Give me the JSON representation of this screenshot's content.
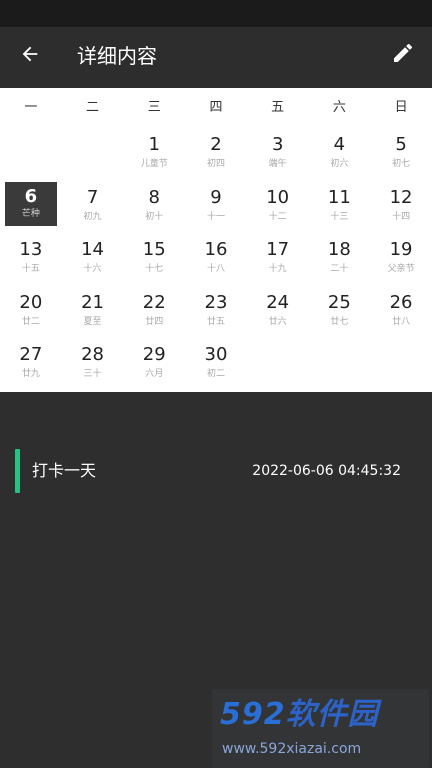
{
  "appbar": {
    "title": "详细内容",
    "back_icon": "arrow-back-icon",
    "edit_icon": "pencil-edit-icon"
  },
  "calendar": {
    "weekdays": [
      "一",
      "二",
      "三",
      "四",
      "五",
      "六",
      "日"
    ],
    "selected_day": "6",
    "weeks": [
      [
        {
          "day": "",
          "lunar": ""
        },
        {
          "day": "",
          "lunar": ""
        },
        {
          "day": "1",
          "lunar": "儿童节"
        },
        {
          "day": "2",
          "lunar": "初四"
        },
        {
          "day": "3",
          "lunar": "端午"
        },
        {
          "day": "4",
          "lunar": "初六"
        },
        {
          "day": "5",
          "lunar": "初七"
        }
      ],
      [
        {
          "day": "6",
          "lunar": "芒种"
        },
        {
          "day": "7",
          "lunar": "初九"
        },
        {
          "day": "8",
          "lunar": "初十"
        },
        {
          "day": "9",
          "lunar": "十一"
        },
        {
          "day": "10",
          "lunar": "十二"
        },
        {
          "day": "11",
          "lunar": "十三"
        },
        {
          "day": "12",
          "lunar": "十四"
        }
      ],
      [
        {
          "day": "13",
          "lunar": "十五"
        },
        {
          "day": "14",
          "lunar": "十六"
        },
        {
          "day": "15",
          "lunar": "十七"
        },
        {
          "day": "16",
          "lunar": "十八"
        },
        {
          "day": "17",
          "lunar": "十九"
        },
        {
          "day": "18",
          "lunar": "二十"
        },
        {
          "day": "19",
          "lunar": "父亲节"
        }
      ],
      [
        {
          "day": "20",
          "lunar": "廿二"
        },
        {
          "day": "21",
          "lunar": "夏至"
        },
        {
          "day": "22",
          "lunar": "廿四"
        },
        {
          "day": "23",
          "lunar": "廿五"
        },
        {
          "day": "24",
          "lunar": "廿六"
        },
        {
          "day": "25",
          "lunar": "廿七"
        },
        {
          "day": "26",
          "lunar": "廿八"
        }
      ],
      [
        {
          "day": "27",
          "lunar": "廿九"
        },
        {
          "day": "28",
          "lunar": "三十"
        },
        {
          "day": "29",
          "lunar": "六月"
        },
        {
          "day": "30",
          "lunar": "初二"
        },
        {
          "day": "",
          "lunar": ""
        },
        {
          "day": "",
          "lunar": ""
        },
        {
          "day": "",
          "lunar": ""
        }
      ]
    ]
  },
  "record": {
    "title": "打卡一天",
    "time": "2022-06-06 04:45:32",
    "accent_color": "#26c281"
  },
  "watermark": {
    "logo_digits": "592",
    "logo_text": "软件园",
    "url": "www.592xiazai.com"
  }
}
